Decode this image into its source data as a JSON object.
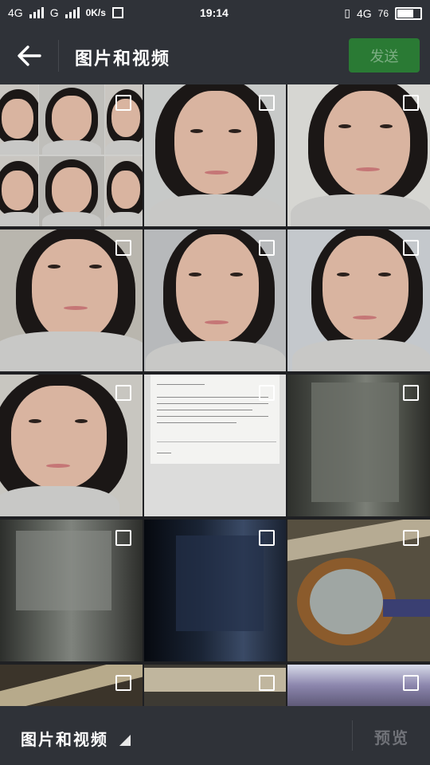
{
  "status_bar": {
    "net1": "4G",
    "net2": "G",
    "speed": "0K/s",
    "time": "19:14",
    "net3": "4G",
    "battery": "76",
    "battery_level": 0.76
  },
  "header": {
    "title": "图片和视频",
    "send_label": "发送"
  },
  "grid": {
    "items": [
      {
        "kind": "collage",
        "selected": false
      },
      {
        "kind": "face",
        "selected": false
      },
      {
        "kind": "face",
        "selected": false
      },
      {
        "kind": "face",
        "selected": false
      },
      {
        "kind": "face",
        "selected": false
      },
      {
        "kind": "face",
        "selected": false
      },
      {
        "kind": "face",
        "selected": false
      },
      {
        "kind": "document",
        "selected": false
      },
      {
        "kind": "meter-box",
        "selected": false
      },
      {
        "kind": "meter-box",
        "selected": false
      },
      {
        "kind": "dark-box",
        "selected": false
      },
      {
        "kind": "water-meter",
        "selected": false
      },
      {
        "kind": "pipe",
        "selected": false
      },
      {
        "kind": "pipe",
        "selected": false
      },
      {
        "kind": "flowers",
        "selected": false
      }
    ]
  },
  "bottom_bar": {
    "album_label": "图片和视频",
    "preview_label": "预览"
  },
  "colors": {
    "bar": "#2f3238",
    "send_bg": "#2a7a34",
    "send_text": "#7cae83"
  }
}
